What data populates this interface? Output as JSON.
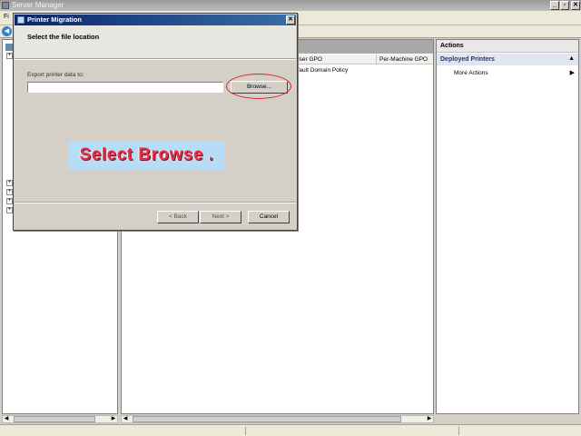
{
  "window": {
    "title": "Server Manager",
    "min_glyph": "_",
    "max_glyph": "▫",
    "close_glyph": "✕",
    "icon": "server-manager-icon"
  },
  "menu": {
    "file_label": "Fi"
  },
  "toolbar": {
    "back_glyph": "◀",
    "icon": "back-arrow-icon"
  },
  "tree": {
    "expand_glyph": "+"
  },
  "center": {
    "columns": [
      "er-User GPO",
      "Per-Machine GPO"
    ],
    "row_policy": "efault Domain Policy"
  },
  "actions": {
    "title": "Actions",
    "section": "Deployed Printers",
    "section_caret": "▲",
    "more_actions": "More Actions",
    "more_arrow": "▶"
  },
  "scroll": {
    "left": "◀",
    "right": "▶"
  },
  "dialog": {
    "title": "Printer Migration",
    "close_glyph": "✕",
    "heading": "Select the file location",
    "export_label": "Export printer data to:",
    "export_value": "",
    "browse_label": "Browse...",
    "back_label": "< Back",
    "next_label": "Next >",
    "cancel_label": "Cancel"
  },
  "callout": {
    "text": "Select Browse ."
  },
  "colors": {
    "dialog_title": "#0a246a",
    "highlight_ring": "#e02020",
    "callout_bg": "#b6dcf6",
    "callout_text": "#e7314a"
  }
}
